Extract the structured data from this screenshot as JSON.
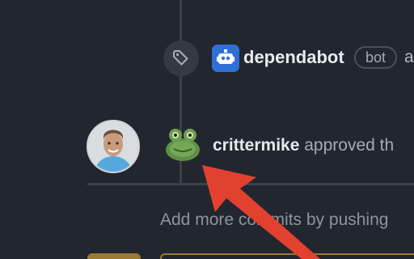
{
  "timeline": {
    "event": {
      "icon": "tag-icon",
      "actor_avatar_icon": "dependabot-robot-icon",
      "actor_name": "dependabot",
      "actor_badge": "bot",
      "action_text_fragment": "a"
    },
    "review": {
      "reviewer_avatar": "user-avatar",
      "badge_avatar": "frog-avatar",
      "reviewer_name": "crittermike",
      "action_text": "approved th"
    },
    "hint_text": "Add more commits by pushing"
  },
  "annotation": {
    "arrow_color": "#e3412f",
    "icon": "red-arrow-pointer-icon"
  },
  "colors": {
    "background": "#22262e",
    "timeline": "#3b4049",
    "dependabot_blue": "#2f6fd6",
    "warning_gold": "#9b7a34"
  }
}
